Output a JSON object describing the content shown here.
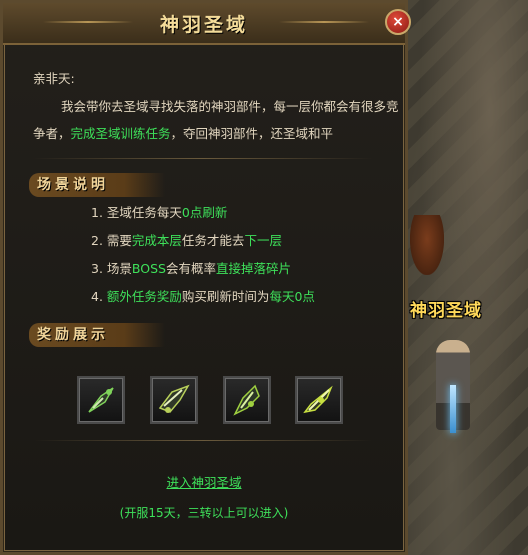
{
  "scene": {
    "label": "神羽圣域"
  },
  "dialog": {
    "title": "神羽圣域",
    "close_label": "×",
    "greeting": "亲非天:",
    "paragraph": {
      "line1": "我会带你去圣域寻找失落的神羽部件，每一层你都会有很多竞",
      "line2_a": "争者，",
      "line2_link": "完成圣域训练任务",
      "line2_b": "，夺回神羽部件，还圣域和平"
    },
    "scene_header": "场景说明",
    "rules": [
      {
        "a": "1. 圣域任务每天",
        "b": "0点刷新",
        "c": ""
      },
      {
        "a": "2. 需要",
        "b": "完成本层",
        "c": "任务才能去",
        "d": "下一层"
      },
      {
        "a": "3. 场景",
        "b": "BOSS",
        "c": "会有概率",
        "d": "直接掉落碎片"
      },
      {
        "a": "4. ",
        "b": "额外任务奖励",
        "c": "购买刷新时间为",
        "d": "每天0点"
      }
    ],
    "reward_header": "奖励展示",
    "rewards": [
      {
        "icon": "feather-part-icon",
        "color": "#7fd35a"
      },
      {
        "icon": "feather-part-icon",
        "color": "#b8d05a"
      },
      {
        "icon": "feather-part-icon",
        "color": "#9fd040"
      },
      {
        "icon": "feather-part-icon",
        "color": "#c8e040"
      }
    ],
    "enter_link": "进入神羽圣域",
    "condition": "(开服15天，三转以上可以进入)"
  },
  "colors": {
    "accent_green": "#3ee05a",
    "title_gold": "#f4dc9a",
    "text": "#e2d6bf"
  }
}
